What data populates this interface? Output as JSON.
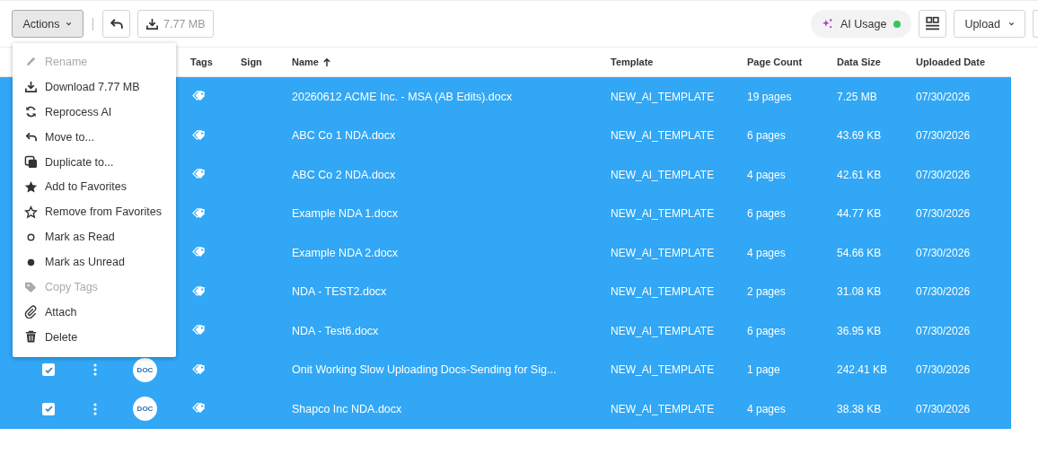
{
  "toolbar": {
    "actions_button": {
      "label": "Actions",
      "expanded": true
    },
    "download_button": {
      "label": "7.77 MB"
    },
    "ai_usage": {
      "label": "AI Usage",
      "color": "#34c759"
    },
    "upload_button": {
      "label": "Upload"
    }
  },
  "menu": {
    "items": [
      {
        "label": "Rename",
        "disabled": true
      },
      {
        "label": "Download 7.77 MB",
        "disabled": false
      },
      {
        "label": "Reprocess AI",
        "disabled": false
      },
      {
        "label": "Move to...",
        "disabled": false
      },
      {
        "label": "Duplicate to...",
        "disabled": false
      },
      {
        "label": "Add to Favorites",
        "disabled": false
      },
      {
        "label": "Remove from Favorites",
        "disabled": false
      },
      {
        "label": "Mark as Read",
        "disabled": false
      },
      {
        "label": "Mark as Unread",
        "disabled": false
      },
      {
        "label": "Copy Tags",
        "disabled": true
      },
      {
        "label": "Attach",
        "disabled": false
      },
      {
        "label": "Delete",
        "disabled": false
      }
    ]
  },
  "table": {
    "columns": [
      {
        "label": "Tags",
        "sorted": false
      },
      {
        "label": "Sign",
        "sorted": false
      },
      {
        "label": "Name",
        "sorted": true
      },
      {
        "label": "Template",
        "sorted": false
      },
      {
        "label": "Page Count",
        "sorted": false
      },
      {
        "label": "Data Size",
        "sorted": false
      },
      {
        "label": "Uploaded Date",
        "sorted": false
      }
    ],
    "rows": [
      {
        "selected": true,
        "name": "20260612 ACME Inc. - MSA (AB Edits).docx",
        "template": "NEW_AI_TEMPLATE",
        "page_count": "19 pages",
        "data_size": "7.25 MB",
        "uploaded": "07/30/2026"
      },
      {
        "selected": true,
        "name": "ABC Co 1 NDA.docx",
        "template": "NEW_AI_TEMPLATE",
        "page_count": "6 pages",
        "data_size": "43.69 KB",
        "uploaded": "07/30/2026"
      },
      {
        "selected": true,
        "name": "ABC Co 2 NDA.docx",
        "template": "NEW_AI_TEMPLATE",
        "page_count": "4 pages",
        "data_size": "42.61 KB",
        "uploaded": "07/30/2026"
      },
      {
        "selected": true,
        "name": "Example NDA 1.docx",
        "template": "NEW_AI_TEMPLATE",
        "page_count": "6 pages",
        "data_size": "44.77 KB",
        "uploaded": "07/30/2026"
      },
      {
        "selected": true,
        "name": "Example NDA 2.docx",
        "template": "NEW_AI_TEMPLATE",
        "page_count": "4 pages",
        "data_size": "54.66 KB",
        "uploaded": "07/30/2026"
      },
      {
        "selected": true,
        "name": "NDA - TEST2.docx",
        "template": "NEW_AI_TEMPLATE",
        "page_count": "2 pages",
        "data_size": "31.08 KB",
        "uploaded": "07/30/2026"
      },
      {
        "selected": true,
        "name": "NDA - Test6.docx",
        "template": "NEW_AI_TEMPLATE",
        "page_count": "6 pages",
        "data_size": "36.95 KB",
        "uploaded": "07/30/2026"
      },
      {
        "selected": true,
        "checked": true,
        "badge": "DOC",
        "name": "Onit Working Slow Uploading Docs-Sending for Sig...",
        "template": "NEW_AI_TEMPLATE",
        "page_count": "1 page",
        "data_size": "242.41 KB",
        "uploaded": "07/30/2026"
      },
      {
        "selected": true,
        "checked": true,
        "badge": "DOC",
        "name": "Shapco Inc NDA.docx",
        "template": "NEW_AI_TEMPLATE",
        "page_count": "4 pages",
        "data_size": "38.38 KB",
        "uploaded": "07/30/2026"
      }
    ]
  }
}
